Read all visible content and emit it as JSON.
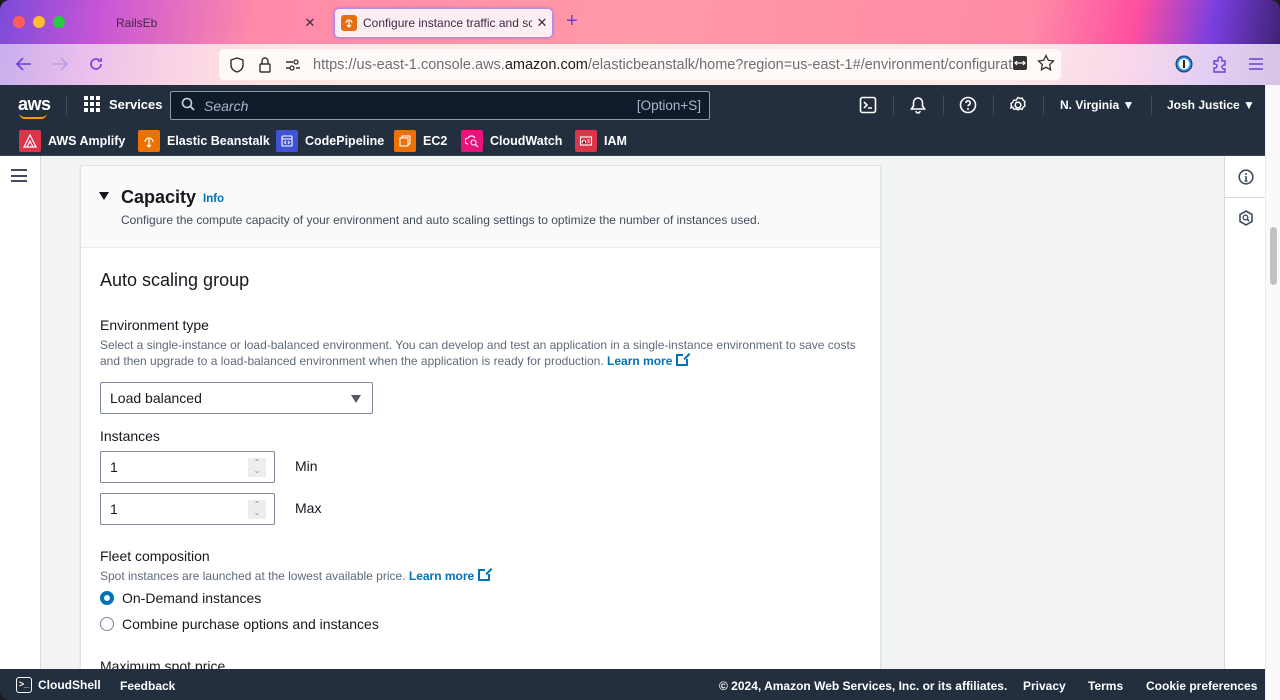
{
  "browser": {
    "tabs": [
      {
        "title": "RailsEb",
        "active": false
      },
      {
        "title": "Configure instance traffic and sc",
        "active": true
      }
    ],
    "url_prefix": "https://us-east-1.console.aws.",
    "url_domain": "amazon.com",
    "url_suffix": "/elasticbeanstalk/home?region=us-east-1#/environment/configurat",
    "new_tab_icon": "plus",
    "tab_list_icon": "chevron-down"
  },
  "aws_header": {
    "logo": "aws",
    "services_label": "Services",
    "search_placeholder": "Search",
    "search_shortcut": "[Option+S]",
    "region": "N. Virginia",
    "user": "Josh Justice",
    "icons": [
      "cloudshell-icon",
      "bell-icon",
      "help-icon",
      "gear-icon"
    ]
  },
  "favorites": [
    {
      "label": "AWS Amplify",
      "color": "#dd344c"
    },
    {
      "label": "Elastic Beanstalk",
      "color": "#ed7100"
    },
    {
      "label": "CodePipeline",
      "color": "#4053d6"
    },
    {
      "label": "EC2",
      "color": "#ed7100"
    },
    {
      "label": "CloudWatch",
      "color": "#e7157b"
    },
    {
      "label": "IAM",
      "color": "#dd344c"
    }
  ],
  "capacity": {
    "title": "Capacity",
    "info": "Info",
    "description": "Configure the compute capacity of your environment and auto scaling settings to optimize the number of instances used."
  },
  "auto_scaling": {
    "title": "Auto scaling group",
    "environment_type": {
      "label": "Environment type",
      "description": "Select a single-instance or load-balanced environment. You can develop and test an application in a single-instance environment to save costs and then upgrade to a load-balanced environment when the application is ready for production.",
      "learn_more": "Learn more",
      "selected": "Load balanced"
    },
    "instances": {
      "label": "Instances",
      "min_value": "1",
      "min_label": "Min",
      "max_value": "1",
      "max_label": "Max"
    },
    "fleet": {
      "label": "Fleet composition",
      "description": "Spot instances are launched at the lowest available price.",
      "learn_more": "Learn more",
      "options": [
        {
          "label": "On-Demand instances",
          "checked": true
        },
        {
          "label": "Combine purchase options and instances",
          "checked": false
        }
      ]
    },
    "max_spot_price_label": "Maximum spot price"
  },
  "footer": {
    "cloudshell": "CloudShell",
    "feedback": "Feedback",
    "copyright": "© 2024, Amazon Web Services, Inc. or its affiliates.",
    "privacy": "Privacy",
    "terms": "Terms",
    "cookies": "Cookie preferences"
  },
  "colors": {
    "aws_nav": "#232f3e",
    "link": "#0073bb",
    "page_bg": "#f2f3f3"
  }
}
